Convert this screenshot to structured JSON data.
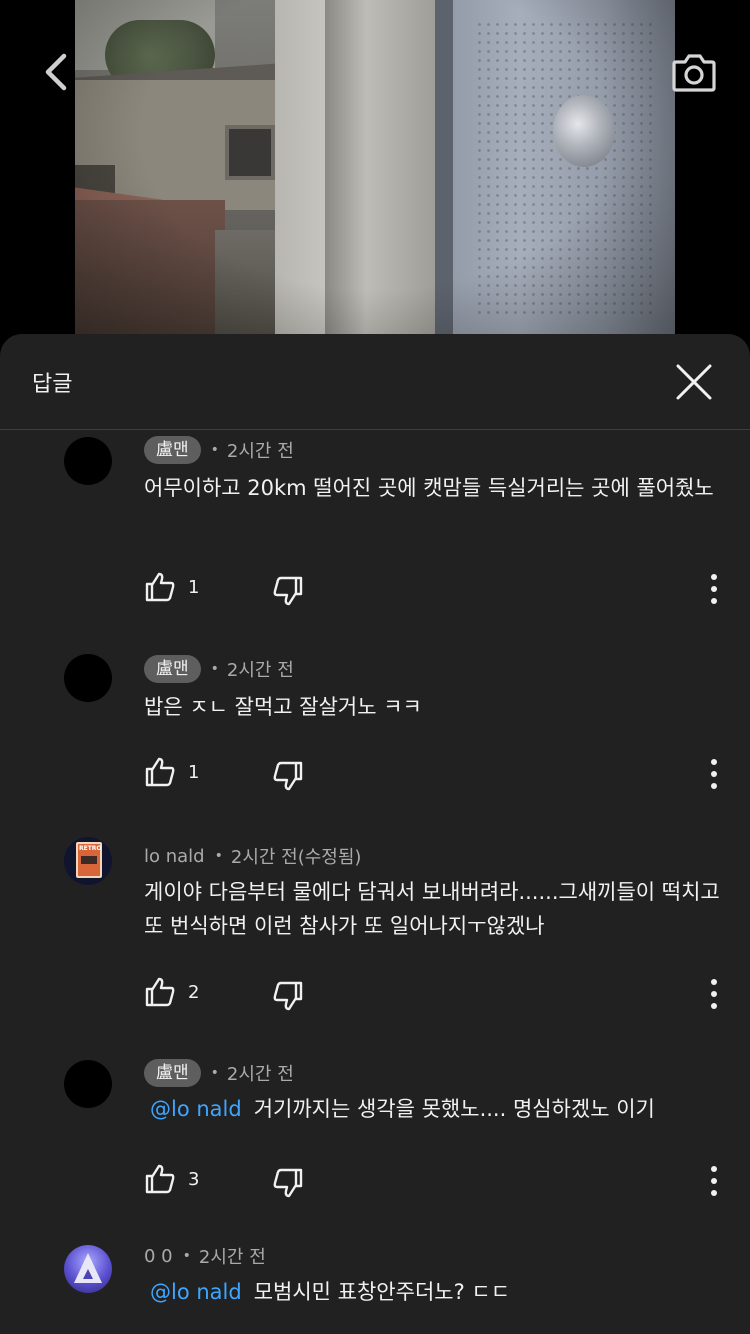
{
  "header": {
    "back_icon": "chevron-left-icon",
    "camera_icon": "camera-icon"
  },
  "sheet": {
    "title": "답글",
    "close_icon": "close-icon"
  },
  "comments": [
    {
      "author": "盧맨",
      "author_style": "chip",
      "avatar": "black-circle",
      "time": "2시간 전",
      "mention": "",
      "text": "어무이하고 20km 떨어진 곳에 캣맘들 득실거리는 곳에 풀어줬노",
      "likes": "1"
    },
    {
      "author": "盧맨",
      "author_style": "chip",
      "avatar": "black-circle",
      "time": "2시간 전",
      "mention": "",
      "text": "밥은 ㅈㄴ 잘먹고 잘살거노 ㅋㅋ",
      "likes": "1"
    },
    {
      "author": "lo nald",
      "author_style": "plain",
      "avatar": "retro-cassette",
      "avatar_text": "RETRO",
      "time": "2시간 전(수정됨)",
      "mention": "",
      "text": "게이야 다음부터 물에다 담궈서 보내버려라......그새끼들이 떡치고 또 번식하면 이런 참사가 또 일어나지ㅜ않겠나",
      "likes": "2"
    },
    {
      "author": "盧맨",
      "author_style": "chip",
      "avatar": "black-circle",
      "time": "2시간 전",
      "mention": "@lo nald",
      "text": "거기까지는 생각을 못했노.... 명심하겠노 이기",
      "likes": "3"
    },
    {
      "author": "0 0",
      "author_style": "plain",
      "avatar": "purple-a",
      "time": "2시간 전",
      "mention": "@lo nald",
      "text": "모범시민 표창안주더노? ㄷㄷ",
      "likes": ""
    }
  ],
  "icons": {
    "like": "thumbs-up-icon",
    "dislike": "thumbs-down-icon",
    "more": "more-vertical-icon"
  },
  "colors": {
    "sheet_bg": "#212121",
    "mention": "#3ea6ff",
    "chip_bg": "#5e5e5e",
    "text": "#f1f1f1",
    "meta": "#aaaaaa"
  }
}
